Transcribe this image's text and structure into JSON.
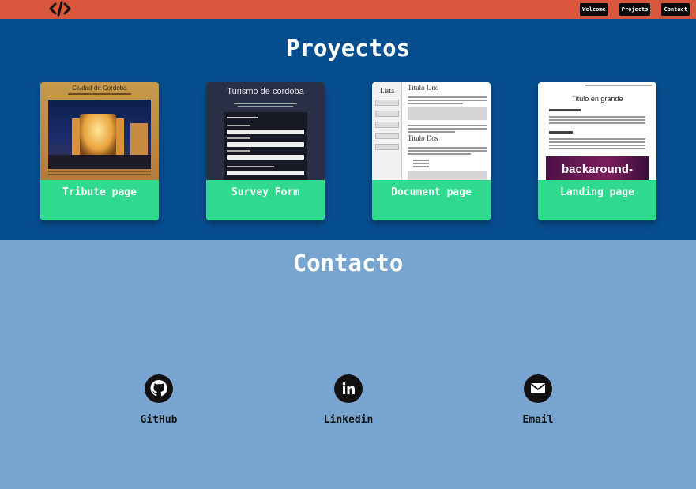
{
  "nav": {
    "logo_icon": "code-icon",
    "links": [
      "Welcome",
      "Projects",
      "Contact"
    ]
  },
  "projects": {
    "title": "Proyectos",
    "cards": [
      {
        "label": "Tribute page",
        "thumb_title": "Ciudad de Cordoba"
      },
      {
        "label": "Survey Form",
        "thumb_title": "Turismo de cordoba"
      },
      {
        "label": "Document page",
        "thumb_title": "Titulo Uno",
        "thumb_side": "Lista",
        "thumb_sub": "Titulo Dos"
      },
      {
        "label": "Landing page",
        "thumb_title": "Titulo en grande",
        "thumb_banner": "backaround-"
      }
    ]
  },
  "contact": {
    "title": "Contacto",
    "items": [
      {
        "label": "GitHub",
        "icon": "github-icon"
      },
      {
        "label": "Linkedin",
        "icon": "linkedin-icon"
      },
      {
        "label": "Email",
        "icon": "email-icon"
      }
    ]
  },
  "colors": {
    "navbar": "#d9563d",
    "projects_bg": "#074e8f",
    "contact_bg": "#78a5cf",
    "card_accent": "#2fd98d"
  }
}
